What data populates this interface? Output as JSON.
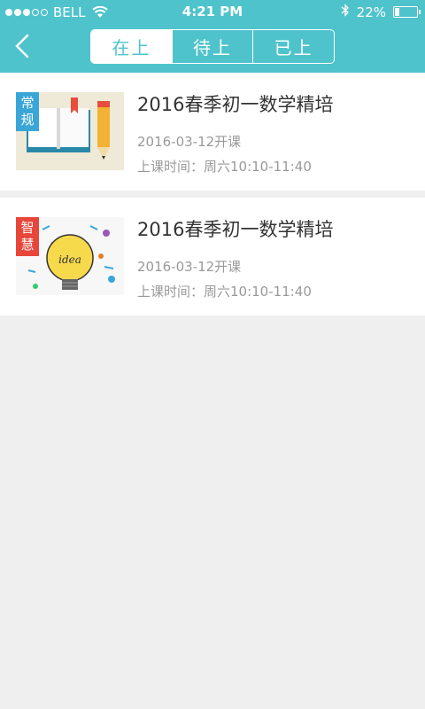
{
  "status": {
    "carrier": "BELL",
    "time": "4:21 PM",
    "battery": "22%",
    "battery_level": 0.22
  },
  "tabs": [
    {
      "label": "在上",
      "active": true
    },
    {
      "label": "待上",
      "active": false
    },
    {
      "label": "已上",
      "active": false
    }
  ],
  "courses": [
    {
      "title": "2016春季初一数学精培",
      "date": "2016-03-12开课",
      "time": "上课时间：周六10:10-11:40",
      "tag": "常规",
      "tag_color": "#3aa6d8",
      "thumb": "book-pencil-image"
    },
    {
      "title": "2016春季初一数学精培",
      "date": "2016-03-12开课",
      "time": "上课时间：周六10:10-11:40",
      "tag": "智慧",
      "tag_color": "#e8463a",
      "thumb": "idea-bulb-image"
    }
  ],
  "colors": {
    "header": "#4fc3cc",
    "background": "#efefef"
  }
}
